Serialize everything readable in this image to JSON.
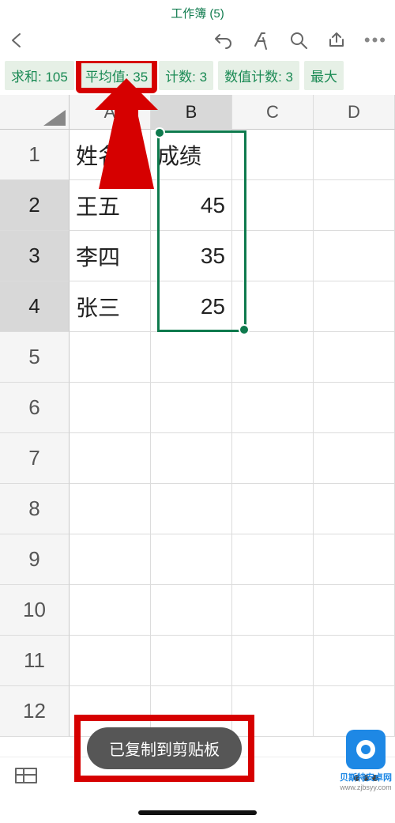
{
  "title": "工作簿 (5)",
  "stats": {
    "sum": "求和: 105",
    "avg": "平均值: 35",
    "count": "计数: 3",
    "numcount": "数值计数: 3",
    "max": "最大"
  },
  "columns": [
    "A",
    "B",
    "C",
    "D"
  ],
  "rows": [
    "1",
    "2",
    "3",
    "4",
    "5",
    "6",
    "7",
    "8",
    "9",
    "10",
    "11",
    "12"
  ],
  "cells": {
    "A1": "姓名",
    "B1": "成绩",
    "A2": "王五",
    "B2": "45",
    "A3": "李四",
    "B3": "35",
    "A4": "张三",
    "B4": "25"
  },
  "chart_data": {
    "type": "table",
    "title": "成绩",
    "headers": [
      "姓名",
      "成绩"
    ],
    "rows": [
      [
        "王五",
        45
      ],
      [
        "李四",
        35
      ],
      [
        "张三",
        25
      ]
    ],
    "aggregates": {
      "sum": 105,
      "average": 35,
      "count": 3,
      "num_count": 3
    }
  },
  "toast": "已复制到剪贴板",
  "watermark": {
    "site": "贝斯特安卓网",
    "url": "www.zjbsyy.com"
  }
}
